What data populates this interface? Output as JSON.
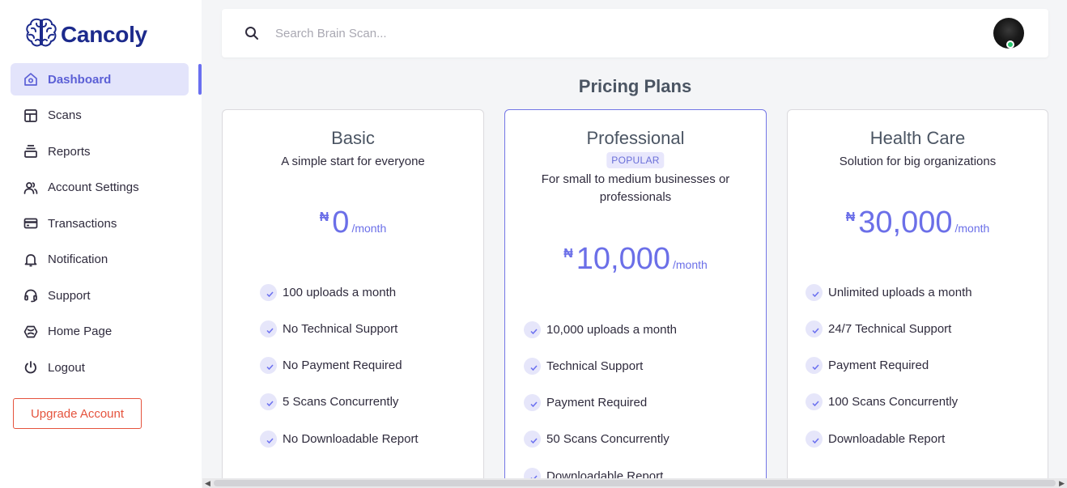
{
  "brand": {
    "name": "Cancoly",
    "accent": "#6a6ff0",
    "logo_color": "#1c2a8c"
  },
  "sidebar": {
    "items": [
      {
        "label": "Dashboard",
        "icon": "home-icon",
        "active": true
      },
      {
        "label": "Scans",
        "icon": "layout-icon"
      },
      {
        "label": "Reports",
        "icon": "stack-icon"
      },
      {
        "label": "Account Settings",
        "icon": "users-icon"
      },
      {
        "label": "Transactions",
        "icon": "credit-card-icon"
      },
      {
        "label": "Notification",
        "icon": "bell-icon"
      },
      {
        "label": "Support",
        "icon": "headset-icon"
      },
      {
        "label": "Home Page",
        "icon": "globe-icon"
      },
      {
        "label": "Logout",
        "icon": "power-icon"
      }
    ],
    "upgrade_label": "Upgrade Account"
  },
  "search": {
    "placeholder": "Search Brain Scan..."
  },
  "page": {
    "title": "Pricing Plans"
  },
  "plans": [
    {
      "name": "Basic",
      "subtitle": "A simple start for everyone",
      "currency": "₦",
      "price": "0",
      "period": "/month",
      "features": [
        "100 uploads a month",
        "No Technical Support",
        "No Payment Required",
        "5 Scans Concurrently",
        "No Downloadable Report"
      ]
    },
    {
      "name": "Professional",
      "badge": "POPULAR",
      "subtitle": "For small to medium businesses or professionals",
      "currency": "₦",
      "price": "10,000",
      "period": "/month",
      "features": [
        "10,000 uploads a month",
        "Technical Support",
        "Payment Required",
        "50 Scans Concurrently",
        "Downloadable Report"
      ]
    },
    {
      "name": "Health Care",
      "subtitle": "Solution for big organizations",
      "currency": "₦",
      "price": "30,000",
      "period": "/month",
      "features": [
        "Unlimited uploads a month",
        "24/7 Technical Support",
        "Payment Required",
        "100 Scans Concurrently",
        "Downloadable Report"
      ]
    }
  ]
}
